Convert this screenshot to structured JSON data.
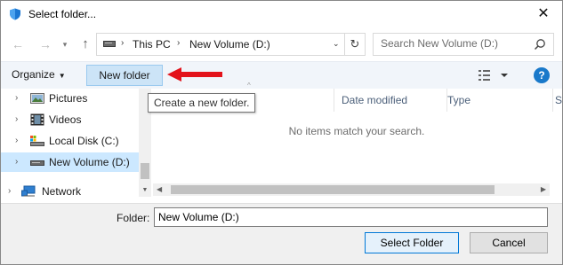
{
  "window": {
    "title": "Select folder...",
    "close_glyph": "✕"
  },
  "nav": {
    "back_glyph": "←",
    "forward_glyph": "→",
    "recent_glyph": "▾",
    "up_glyph": "↑",
    "address": {
      "sep": "›",
      "crumb1": "This PC",
      "crumb2": "New Volume (D:)",
      "dropdown_glyph": "⌄",
      "refresh_glyph": "↻"
    },
    "search": {
      "placeholder": "Search New Volume (D:)"
    }
  },
  "toolbar": {
    "organize_label": "Organize",
    "organize_caret": "▼",
    "new_folder_label": "New folder",
    "help_label": "?"
  },
  "tooltip": {
    "text": "Create a new folder."
  },
  "tree": {
    "items": [
      {
        "label": "Pictures",
        "chevron": "›",
        "icon": "pictures-icon"
      },
      {
        "label": "Videos",
        "chevron": "›",
        "icon": "videos-icon"
      },
      {
        "label": "Local Disk (C:)",
        "chevron": "›",
        "icon": "local-disk-icon"
      },
      {
        "label": "New Volume (D:)",
        "chevron": "›",
        "icon": "drive-icon",
        "selected": true
      }
    ],
    "network": {
      "label": "Network",
      "chevron": "›",
      "icon": "network-icon"
    },
    "scroll_down_glyph": "▼"
  },
  "filelist": {
    "columns": {
      "name": "",
      "date": "Date modified",
      "type": "Type",
      "size": "Si"
    },
    "sort_glyph": "^",
    "empty_message": "No items match your search.",
    "scroll_left_glyph": "◀",
    "scroll_right_glyph": "▶"
  },
  "bottom": {
    "folder_label": "Folder:",
    "folder_value": "New Volume (D:)",
    "select_label": "Select Folder",
    "cancel_label": "Cancel"
  },
  "colors": {
    "accent": "#0078d7",
    "selected_bg": "#cce8ff",
    "toolbar_bg": "#f1f5fa",
    "arrow": "#e3131b",
    "help": "#1979ca"
  }
}
